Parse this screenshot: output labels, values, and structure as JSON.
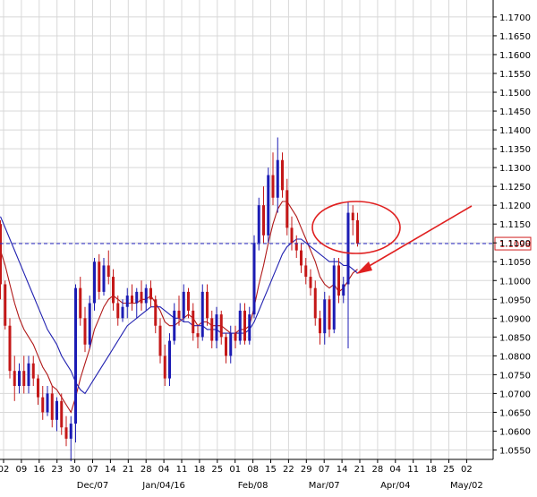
{
  "chart_data": {
    "type": "candlestick",
    "title": "",
    "xlabel": "",
    "ylabel": "",
    "ylim": [
      1.0525,
      1.1745
    ],
    "y_ticks": [
      "1.0550",
      "1.0600",
      "1.0650",
      "1.0700",
      "1.0750",
      "1.0800",
      "1.0850",
      "1.0900",
      "1.0950",
      "1.1000",
      "1.1050",
      "1.1100",
      "1.1150",
      "1.1200",
      "1.1250",
      "1.1300",
      "1.1350",
      "1.1400",
      "1.1450",
      "1.1500",
      "1.1550",
      "1.1600",
      "1.1650",
      "1.1700"
    ],
    "x_ticks": [
      "02",
      "09",
      "16",
      "23",
      "30",
      "07",
      "14",
      "21",
      "28",
      "04",
      "11",
      "18",
      "25",
      "01",
      "08",
      "15",
      "22",
      "29",
      "07",
      "14",
      "21",
      "28",
      "04",
      "11",
      "18",
      "25",
      "02"
    ],
    "x_month_labels": [
      {
        "label": "Dec/07",
        "tick_index": 5
      },
      {
        "label": "Jan/04/16",
        "tick_index": 9
      },
      {
        "label": "Feb/08",
        "tick_index": 14
      },
      {
        "label": "Mar/07",
        "tick_index": 18
      },
      {
        "label": "Apr/04",
        "tick_index": 22
      },
      {
        "label": "May/02",
        "tick_index": 26
      }
    ],
    "grid": true,
    "current_price": 1.1098,
    "current_price_label": "1.1098",
    "colors": {
      "up": "#1c1cb4",
      "down": "#c41818",
      "ma_fast": "#b01818",
      "ma_slow": "#2020b0",
      "grid": "#d8d8d8",
      "price_line": "#2a2ac8",
      "annotation": "#e02020"
    },
    "candles": [
      [
        1.115,
        1.116,
        1.095,
        1.099
      ],
      [
        1.099,
        1.1,
        1.087,
        1.088
      ],
      [
        1.088,
        1.09,
        1.074,
        1.076
      ],
      [
        1.076,
        1.08,
        1.068,
        1.072
      ],
      [
        1.072,
        1.078,
        1.07,
        1.076
      ],
      [
        1.076,
        1.08,
        1.07,
        1.072
      ],
      [
        1.072,
        1.08,
        1.07,
        1.078
      ],
      [
        1.078,
        1.08,
        1.072,
        1.074
      ],
      [
        1.074,
        1.075,
        1.067,
        1.069
      ],
      [
        1.069,
        1.072,
        1.063,
        1.065
      ],
      [
        1.065,
        1.072,
        1.064,
        1.07
      ],
      [
        1.07,
        1.072,
        1.061,
        1.063
      ],
      [
        1.063,
        1.069,
        1.06,
        1.068
      ],
      [
        1.068,
        1.07,
        1.059,
        1.061
      ],
      [
        1.061,
        1.064,
        1.056,
        1.058
      ],
      [
        1.058,
        1.064,
        1.052,
        1.062
      ],
      [
        1.062,
        1.099,
        1.057,
        1.098
      ],
      [
        1.098,
        1.101,
        1.088,
        1.09
      ],
      [
        1.09,
        1.093,
        1.081,
        1.083
      ],
      [
        1.083,
        1.096,
        1.082,
        1.094
      ],
      [
        1.094,
        1.106,
        1.092,
        1.105
      ],
      [
        1.105,
        1.107,
        1.095,
        1.097
      ],
      [
        1.097,
        1.106,
        1.096,
        1.104
      ],
      [
        1.104,
        1.108,
        1.099,
        1.101
      ],
      [
        1.101,
        1.103,
        1.092,
        1.094
      ],
      [
        1.094,
        1.096,
        1.088,
        1.09
      ],
      [
        1.09,
        1.095,
        1.089,
        1.093
      ],
      [
        1.093,
        1.098,
        1.09,
        1.096
      ],
      [
        1.096,
        1.099,
        1.092,
        1.094
      ],
      [
        1.094,
        1.098,
        1.09,
        1.097
      ],
      [
        1.097,
        1.1,
        1.092,
        1.094
      ],
      [
        1.094,
        1.099,
        1.092,
        1.098
      ],
      [
        1.098,
        1.1,
        1.093,
        1.095
      ],
      [
        1.095,
        1.096,
        1.086,
        1.088
      ],
      [
        1.088,
        1.09,
        1.078,
        1.08
      ],
      [
        1.08,
        1.083,
        1.072,
        1.074
      ],
      [
        1.074,
        1.086,
        1.072,
        1.084
      ],
      [
        1.084,
        1.094,
        1.083,
        1.092
      ],
      [
        1.092,
        1.096,
        1.088,
        1.09
      ],
      [
        1.09,
        1.099,
        1.089,
        1.097
      ],
      [
        1.097,
        1.098,
        1.09,
        1.092
      ],
      [
        1.092,
        1.094,
        1.084,
        1.086
      ],
      [
        1.086,
        1.088,
        1.082,
        1.085
      ],
      [
        1.085,
        1.099,
        1.084,
        1.097
      ],
      [
        1.097,
        1.099,
        1.088,
        1.09
      ],
      [
        1.09,
        1.092,
        1.082,
        1.084
      ],
      [
        1.084,
        1.093,
        1.082,
        1.091
      ],
      [
        1.091,
        1.092,
        1.083,
        1.085
      ],
      [
        1.085,
        1.086,
        1.078,
        1.08
      ],
      [
        1.08,
        1.088,
        1.078,
        1.086
      ],
      [
        1.086,
        1.088,
        1.082,
        1.084
      ],
      [
        1.084,
        1.094,
        1.083,
        1.092
      ],
      [
        1.092,
        1.094,
        1.083,
        1.084
      ],
      [
        1.084,
        1.093,
        1.083,
        1.091
      ],
      [
        1.091,
        1.112,
        1.09,
        1.11
      ],
      [
        1.11,
        1.122,
        1.108,
        1.12
      ],
      [
        1.12,
        1.125,
        1.11,
        1.112
      ],
      [
        1.112,
        1.13,
        1.11,
        1.128
      ],
      [
        1.128,
        1.134,
        1.12,
        1.122
      ],
      [
        1.122,
        1.138,
        1.118,
        1.132
      ],
      [
        1.132,
        1.134,
        1.122,
        1.124
      ],
      [
        1.124,
        1.127,
        1.112,
        1.114
      ],
      [
        1.114,
        1.117,
        1.108,
        1.11
      ],
      [
        1.11,
        1.112,
        1.106,
        1.108
      ],
      [
        1.108,
        1.11,
        1.102,
        1.104
      ],
      [
        1.104,
        1.106,
        1.099,
        1.101
      ],
      [
        1.101,
        1.103,
        1.096,
        1.098
      ],
      [
        1.098,
        1.1,
        1.088,
        1.09
      ],
      [
        1.09,
        1.092,
        1.083,
        1.086
      ],
      [
        1.086,
        1.097,
        1.083,
        1.095
      ],
      [
        1.095,
        1.096,
        1.085,
        1.087
      ],
      [
        1.087,
        1.106,
        1.086,
        1.104
      ],
      [
        1.104,
        1.106,
        1.094,
        1.096
      ],
      [
        1.096,
        1.101,
        1.094,
        1.099
      ],
      [
        1.099,
        1.121,
        1.082,
        1.118
      ],
      [
        1.118,
        1.12,
        1.112,
        1.116
      ],
      [
        1.116,
        1.118,
        1.109,
        1.1098
      ]
    ],
    "series": [
      {
        "values": [
          1.108,
          1.104,
          1.099,
          1.094,
          1.09,
          1.087,
          1.085,
          1.083,
          1.08,
          1.077,
          1.075,
          1.072,
          1.071,
          1.069,
          1.067,
          1.065,
          1.069,
          1.074,
          1.078,
          1.082,
          1.087,
          1.09,
          1.093,
          1.095,
          1.096,
          1.095,
          1.094,
          1.094,
          1.094,
          1.094,
          1.095,
          1.095,
          1.096,
          1.094,
          1.092,
          1.089,
          1.088,
          1.088,
          1.089,
          1.09,
          1.091,
          1.09,
          1.088,
          1.089,
          1.089,
          1.088,
          1.088,
          1.088,
          1.087,
          1.086,
          1.086,
          1.087,
          1.087,
          1.088,
          1.093,
          1.099,
          1.104,
          1.11,
          1.115,
          1.119,
          1.121,
          1.121,
          1.119,
          1.117,
          1.114,
          1.111,
          1.108,
          1.105,
          1.101,
          1.099,
          1.098,
          1.099,
          1.097,
          1.098,
          1.1,
          1.102,
          1.103
        ]
      },
      {
        "values": [
          1.117,
          1.114,
          1.111,
          1.108,
          1.105,
          1.102,
          1.099,
          1.096,
          1.093,
          1.09,
          1.087,
          1.085,
          1.083,
          1.08,
          1.078,
          1.076,
          1.073,
          1.071,
          1.07,
          1.072,
          1.074,
          1.076,
          1.078,
          1.08,
          1.082,
          1.084,
          1.086,
          1.088,
          1.089,
          1.09,
          1.091,
          1.092,
          1.093,
          1.093,
          1.093,
          1.092,
          1.091,
          1.09,
          1.09,
          1.089,
          1.089,
          1.088,
          1.088,
          1.088,
          1.087,
          1.087,
          1.087,
          1.086,
          1.086,
          1.086,
          1.086,
          1.086,
          1.086,
          1.087,
          1.089,
          1.092,
          1.095,
          1.098,
          1.101,
          1.104,
          1.107,
          1.109,
          1.11,
          1.111,
          1.111,
          1.11,
          1.109,
          1.108,
          1.107,
          1.106,
          1.105,
          1.105,
          1.105,
          1.104,
          1.104,
          1.103,
          1.102
        ]
      }
    ]
  }
}
